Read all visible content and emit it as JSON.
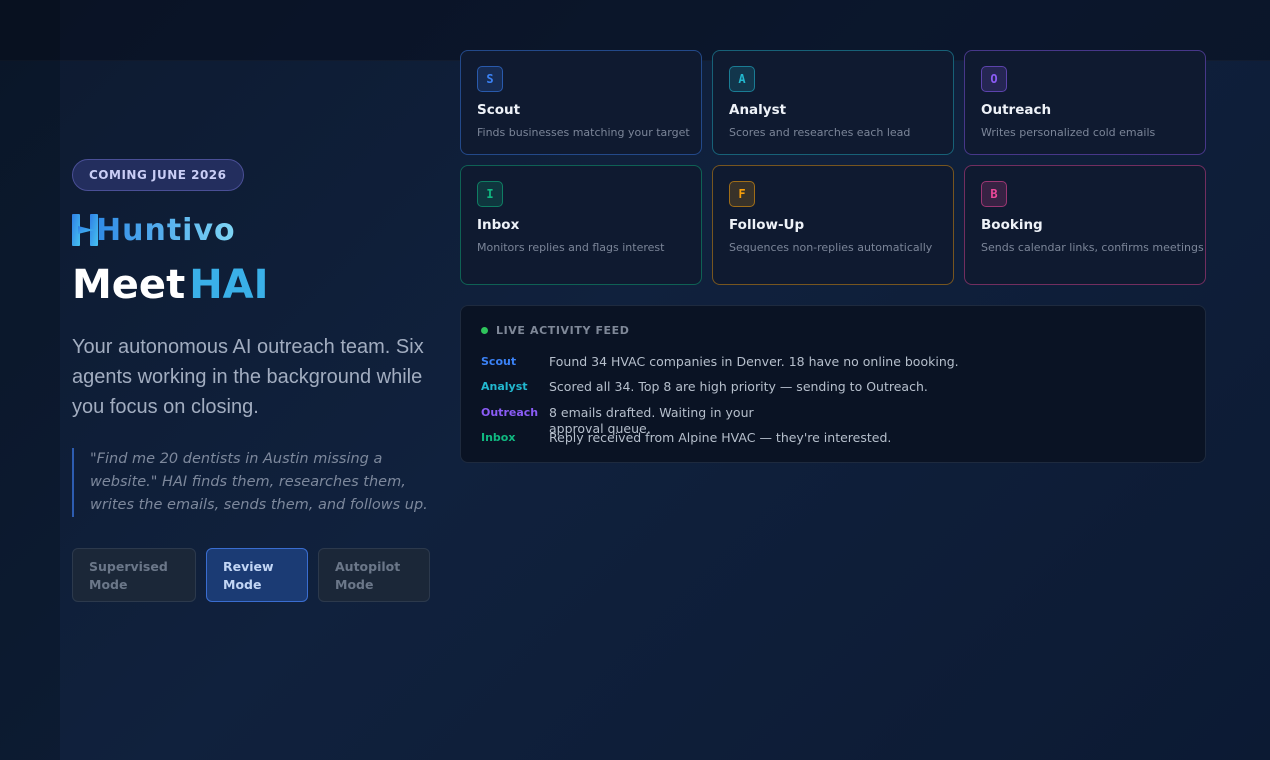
{
  "badge": "COMING JUNE 2026",
  "brand": {
    "logo_text": "Huntivo"
  },
  "hero": {
    "title_part1": "Meet",
    "title_part2": "HAI",
    "description": "Your autonomous AI outreach team. Six agents working in the background while you focus on closing.",
    "quote": "\"Find me 20 dentists in Austin missing a website.\" HAI finds them, researches them, writes the emails, sends them, and follows up."
  },
  "modes": [
    {
      "label": "Supervised Mode",
      "active": false
    },
    {
      "label": "Review Mode",
      "active": true
    },
    {
      "label": "Autopilot Mode",
      "active": false
    }
  ],
  "agents": [
    {
      "letter": "S",
      "name": "Scout",
      "desc": "Finds businesses matching your target",
      "color": "#3b82f6"
    },
    {
      "letter": "A",
      "name": "Analyst",
      "desc": "Scores and researches each lead",
      "color": "#22b8cf"
    },
    {
      "letter": "O",
      "name": "Outreach",
      "desc": "Writes personalized cold emails",
      "color": "#8b5cf6"
    },
    {
      "letter": "I",
      "name": "Inbox",
      "desc": "Monitors replies and flags interest",
      "color": "#10b981"
    },
    {
      "letter": "F",
      "name": "Follow-Up",
      "desc": "Sequences non-replies automatically",
      "color": "#f59e0b"
    },
    {
      "letter": "B",
      "name": "Booking",
      "desc": "Sends calendar links, confirms meetings",
      "color": "#ec4899"
    }
  ],
  "feed": {
    "title": "LIVE ACTIVITY FEED",
    "items": [
      {
        "agent": "Scout",
        "text": "Found 34 HVAC companies in Denver. 18 have no online booking.",
        "color": "#3b82f6"
      },
      {
        "agent": "Analyst",
        "text": "Scored all 34. Top 8 are high priority — sending to Outreach.",
        "color": "#22b8cf"
      },
      {
        "agent": "Outreach",
        "text": "8 emails drafted. Waiting in your approval queue.",
        "color": "#8b5cf6"
      },
      {
        "agent": "Inbox",
        "text": "Reply received from Alpine HVAC — they're interested.",
        "color": "#10b981"
      }
    ]
  }
}
